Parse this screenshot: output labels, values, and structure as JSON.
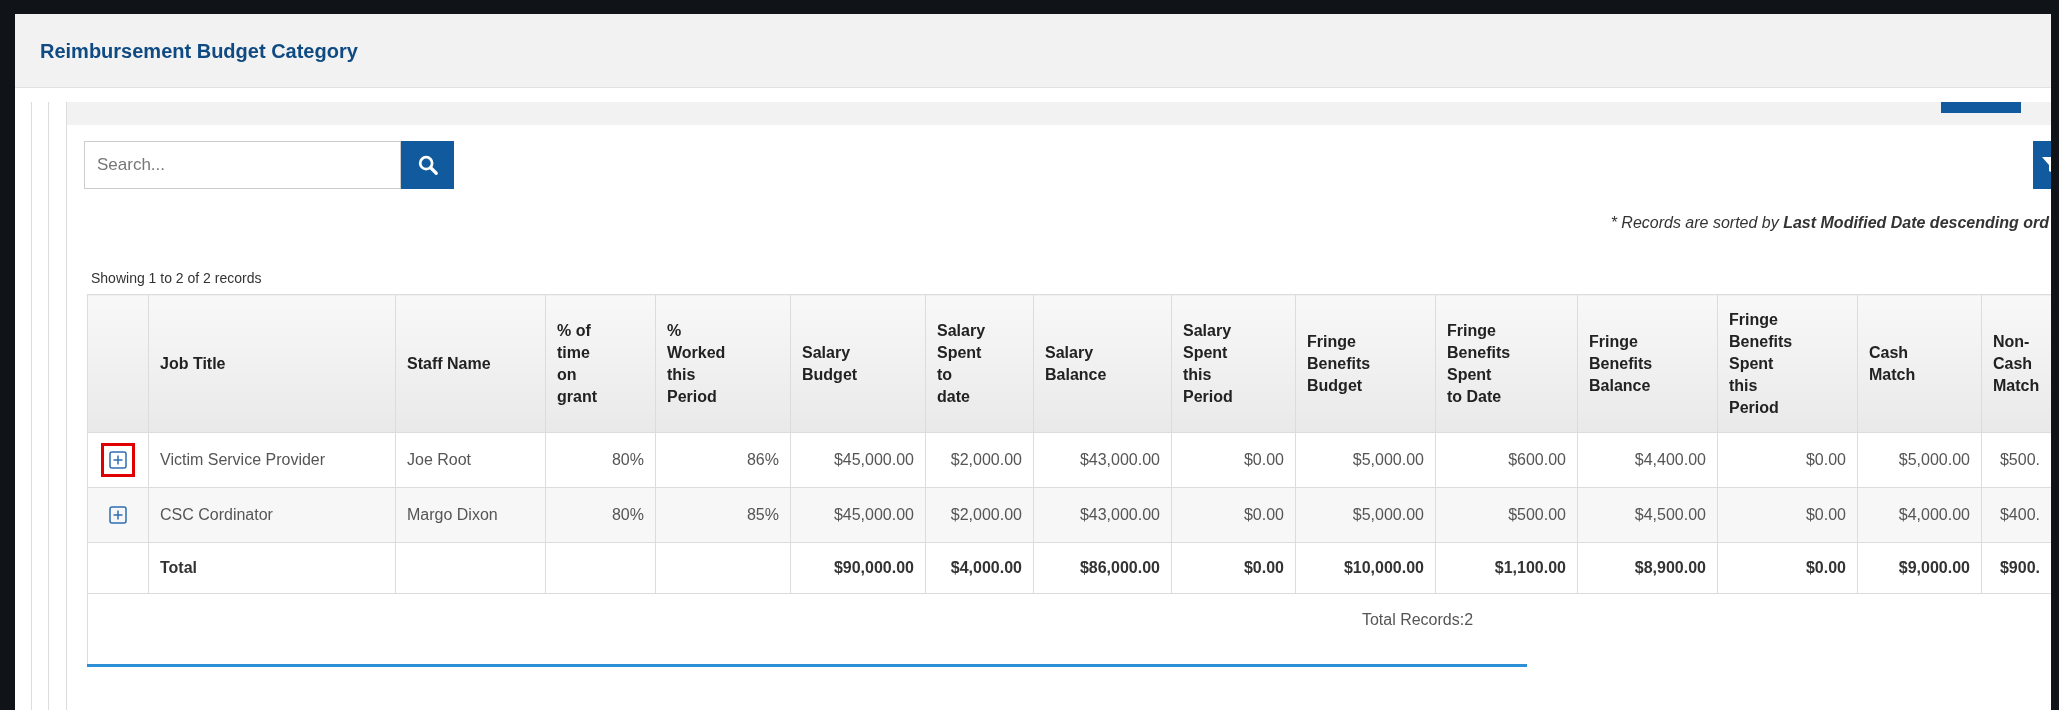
{
  "dialog": {
    "title": "Reimbursement Budget Category"
  },
  "search": {
    "placeholder": "Search..."
  },
  "sort_note": "* Records are sorted by **Last Modified Date descending ord**",
  "showing": "Showing 1 to 2 of 2 records",
  "table": {
    "columns": [
      "Job Title",
      "Staff Name",
      "% of time on grant",
      "% Worked this Period",
      "Salary Budget",
      "Salary Spent to date",
      "Salary Balance",
      "Salary Spent this Period",
      "Fringe Benefits Budget",
      "Fringe Benefits Spent to Date",
      "Fringe Benefits Balance",
      "Fringe Benefits Spent this Period",
      "Cash Match",
      "Non-Cash Match"
    ],
    "rows": [
      {
        "expanded": false,
        "highlighted": true,
        "cells": [
          "Victim Service Provider",
          "Joe Root",
          "80%",
          "86%",
          "$45,000.00",
          "$2,000.00",
          "$43,000.00",
          "$0.00",
          "$5,000.00",
          "$600.00",
          "$4,400.00",
          "$0.00",
          "$5,000.00",
          "$500."
        ]
      },
      {
        "expanded": false,
        "highlighted": false,
        "cells": [
          "CSC Cordinator",
          "Margo Dixon",
          "80%",
          "85%",
          "$45,000.00",
          "$2,000.00",
          "$43,000.00",
          "$0.00",
          "$5,000.00",
          "$500.00",
          "$4,500.00",
          "$0.00",
          "$4,000.00",
          "$400."
        ]
      }
    ],
    "total": {
      "label": "Total",
      "cells": [
        "",
        "",
        "",
        "$90,000.00",
        "$4,000.00",
        "$86,000.00",
        "$0.00",
        "$10,000.00",
        "$1,100.00",
        "$8,900.00",
        "$0.00",
        "$9,000.00",
        "$900."
      ]
    }
  },
  "footer": "Total Records:2"
}
